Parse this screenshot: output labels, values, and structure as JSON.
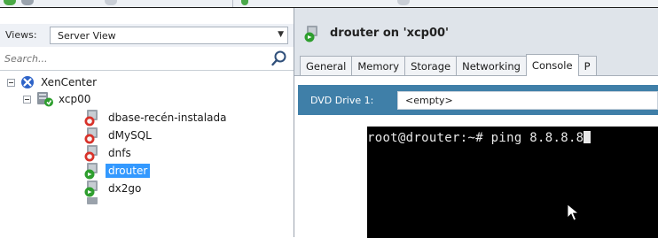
{
  "sidebar": {
    "views_label": "Views:",
    "views_value": "Server View",
    "search_placeholder": "Search...",
    "tree": {
      "root": {
        "label": "XenCenter",
        "icon": "xencenter-icon"
      },
      "pool": {
        "label": "xcp00",
        "icon": "server-icon"
      },
      "vms": [
        {
          "label": "dbase-recén-instalada",
          "icon": "vm-stopped-icon",
          "selected": false
        },
        {
          "label": "dMySQL",
          "icon": "vm-stopped-icon",
          "selected": false
        },
        {
          "label": "dnfs",
          "icon": "vm-stopped-icon",
          "selected": false
        },
        {
          "label": "drouter",
          "icon": "vm-running-icon",
          "selected": true
        },
        {
          "label": "dx2go",
          "icon": "vm-running-icon",
          "selected": false
        }
      ]
    }
  },
  "main": {
    "title": "drouter on 'xcp00'",
    "tabs": [
      {
        "label": "General"
      },
      {
        "label": "Memory"
      },
      {
        "label": "Storage"
      },
      {
        "label": "Networking"
      },
      {
        "label": "Console",
        "active": true
      },
      {
        "label": "P"
      }
    ],
    "dvd_label": "DVD Drive 1:",
    "dvd_value": "<empty>",
    "console_prompt": "root@drouter:~# ping 8.8.8.8"
  },
  "colors": {
    "selection": "#3399ff",
    "dvd_bar": "#3f7fa8",
    "console_bg": "#000000",
    "running_green": "#2e9e2e",
    "stopped_red": "#d8322a"
  }
}
